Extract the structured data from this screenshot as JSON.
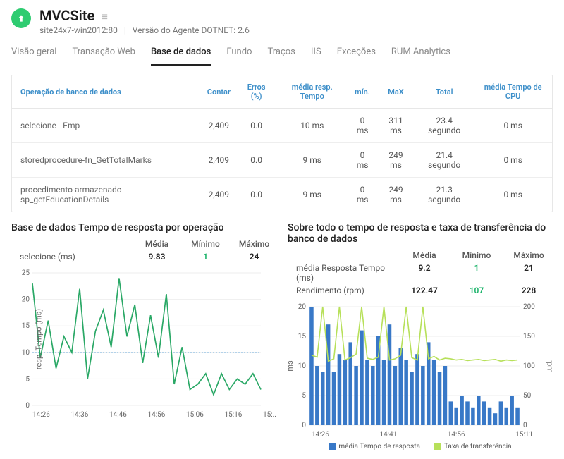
{
  "header": {
    "title": "MVCSite",
    "subtitle_host": "site24x7-win2012:80",
    "subtitle_agent": "Versão do Agente DOTNET: 2.6"
  },
  "tabs": [
    {
      "label": "Visão geral"
    },
    {
      "label": "Transação Web"
    },
    {
      "label": "Base de dados",
      "active": true
    },
    {
      "label": "Fundo"
    },
    {
      "label": "Traços"
    },
    {
      "label": "IIS"
    },
    {
      "label": "Exceções"
    },
    {
      "label": "RUM Analytics"
    }
  ],
  "table": {
    "headers": [
      "Operação de banco de dados",
      "Contar",
      "Erros (%)",
      "média resp. Tempo",
      "mín.",
      "MaX",
      "Total",
      "média Tempo de CPU"
    ],
    "rows": [
      {
        "op": "selecione - Emp",
        "count": "2,409",
        "err": "0.0",
        "avg": "10 ms",
        "min": "0 ms",
        "max": "311 ms",
        "total": "23.4 segundo",
        "cpu": "0 ms"
      },
      {
        "op": "storedprocedure-fn_GetTotalMarks",
        "count": "2,409",
        "err": "0.0",
        "avg": "9 ms",
        "min": "0 ms",
        "max": "249 ms",
        "total": "21.4 segundo",
        "cpu": "0 ms"
      },
      {
        "op": "procedimento armazenado-sp_getEducationDetails",
        "count": "2,409",
        "err": "0.0",
        "avg": "9 ms",
        "min": "0 ms",
        "max": "249 ms",
        "total": "21.3 segundo",
        "cpu": "0 ms"
      }
    ]
  },
  "chart_left": {
    "title": "Base de dados Tempo de resposta por operação",
    "stat_headers": [
      "Média",
      "Mínimo",
      "Máximo"
    ],
    "row_label": "selecione (ms)",
    "media": "9.83",
    "min": "1",
    "max": "24",
    "ylabel": "resp. Tempo (ms)",
    "xticks": [
      "14:26",
      "14:36",
      "14:46",
      "14:56",
      "15:06",
      "15:16",
      "15:.."
    ]
  },
  "chart_right": {
    "title": "Sobre todo o tempo de resposta e taxa de transferência do banco de dados",
    "stat_headers": [
      "Média",
      "Mínimo",
      "Máximo"
    ],
    "rows": [
      {
        "label": "média Resposta Tempo (ms)",
        "media": "9.2",
        "min": "1",
        "max": "21"
      },
      {
        "label": "Rendimento (rpm)",
        "media": "122.47",
        "min": "107",
        "max": "228"
      }
    ],
    "ylabel_left": "ms",
    "ylabel_right": "rpm",
    "xticks": [
      "14:26",
      "14:41",
      "14:56",
      "15:11"
    ],
    "legend": [
      {
        "label": "média Tempo de resposta",
        "color": "blue"
      },
      {
        "label": "Taxa de transferência",
        "color": "green"
      }
    ]
  },
  "chart_data": [
    {
      "type": "line",
      "title": "Base de dados Tempo de resposta por operação",
      "ylabel": "resp. Tempo (ms)",
      "ylim": [
        0,
        25
      ],
      "x": [
        "14:26",
        "14:28",
        "14:30",
        "14:32",
        "14:34",
        "14:36",
        "14:38",
        "14:40",
        "14:42",
        "14:44",
        "14:46",
        "14:48",
        "14:50",
        "14:52",
        "14:54",
        "14:56",
        "14:58",
        "15:00",
        "15:02",
        "15:04",
        "15:06",
        "15:08",
        "15:10",
        "15:12",
        "15:14",
        "15:16",
        "15:18",
        "15:20",
        "15:22",
        "15:24"
      ],
      "series": [
        {
          "name": "selecione (ms)",
          "values": [
            23,
            9,
            16,
            7,
            13,
            10,
            22,
            5,
            14,
            18,
            11,
            24,
            13,
            19,
            8,
            17,
            9,
            21,
            4,
            11,
            3,
            4,
            6,
            2,
            6,
            3,
            5,
            4,
            6,
            3
          ]
        }
      ],
      "reference_line": 10
    },
    {
      "type": "bar+line",
      "title": "Sobre todo o tempo de resposta e taxa de transferência do banco de dados",
      "ylabel": "ms",
      "y2label": "rpm",
      "ylim": [
        0,
        20
      ],
      "y2lim": [
        0,
        200
      ],
      "x": [
        "14:26",
        "14:28",
        "14:30",
        "14:32",
        "14:34",
        "14:36",
        "14:38",
        "14:40",
        "14:42",
        "14:44",
        "14:46",
        "14:48",
        "14:50",
        "14:52",
        "14:54",
        "14:56",
        "14:58",
        "15:00",
        "15:02",
        "15:04",
        "15:06",
        "15:08",
        "15:10",
        "15:12",
        "15:14",
        "15:16",
        "15:18",
        "15:20",
        "15:22",
        "15:24",
        "15:26",
        "15:28",
        "15:30",
        "15:32",
        "15:34",
        "15:36",
        "15:38",
        "15:40"
      ],
      "series": [
        {
          "name": "média Tempo de resposta",
          "axis": "left",
          "type": "bar",
          "values": [
            21,
            10,
            9,
            17,
            9,
            12,
            11,
            14,
            10,
            16,
            11,
            10,
            15,
            11,
            17,
            10,
            13,
            11,
            9,
            12,
            10,
            14,
            11,
            9,
            10,
            4,
            3,
            5,
            4,
            3,
            5,
            4,
            3,
            2,
            4,
            3,
            5,
            3
          ]
        },
        {
          "name": "Taxa de transferência",
          "axis": "right",
          "type": "line",
          "values": [
            118,
            115,
            228,
            108,
            112,
            216,
            110,
            114,
            120,
            220,
            113,
            111,
            115,
            225,
            110,
            112,
            118,
            210,
            114,
            110,
            222,
            112,
            116,
            110,
            113,
            112,
            110,
            111,
            109,
            110,
            111,
            109,
            110,
            111,
            108,
            110,
            109,
            110
          ]
        }
      ]
    }
  ]
}
